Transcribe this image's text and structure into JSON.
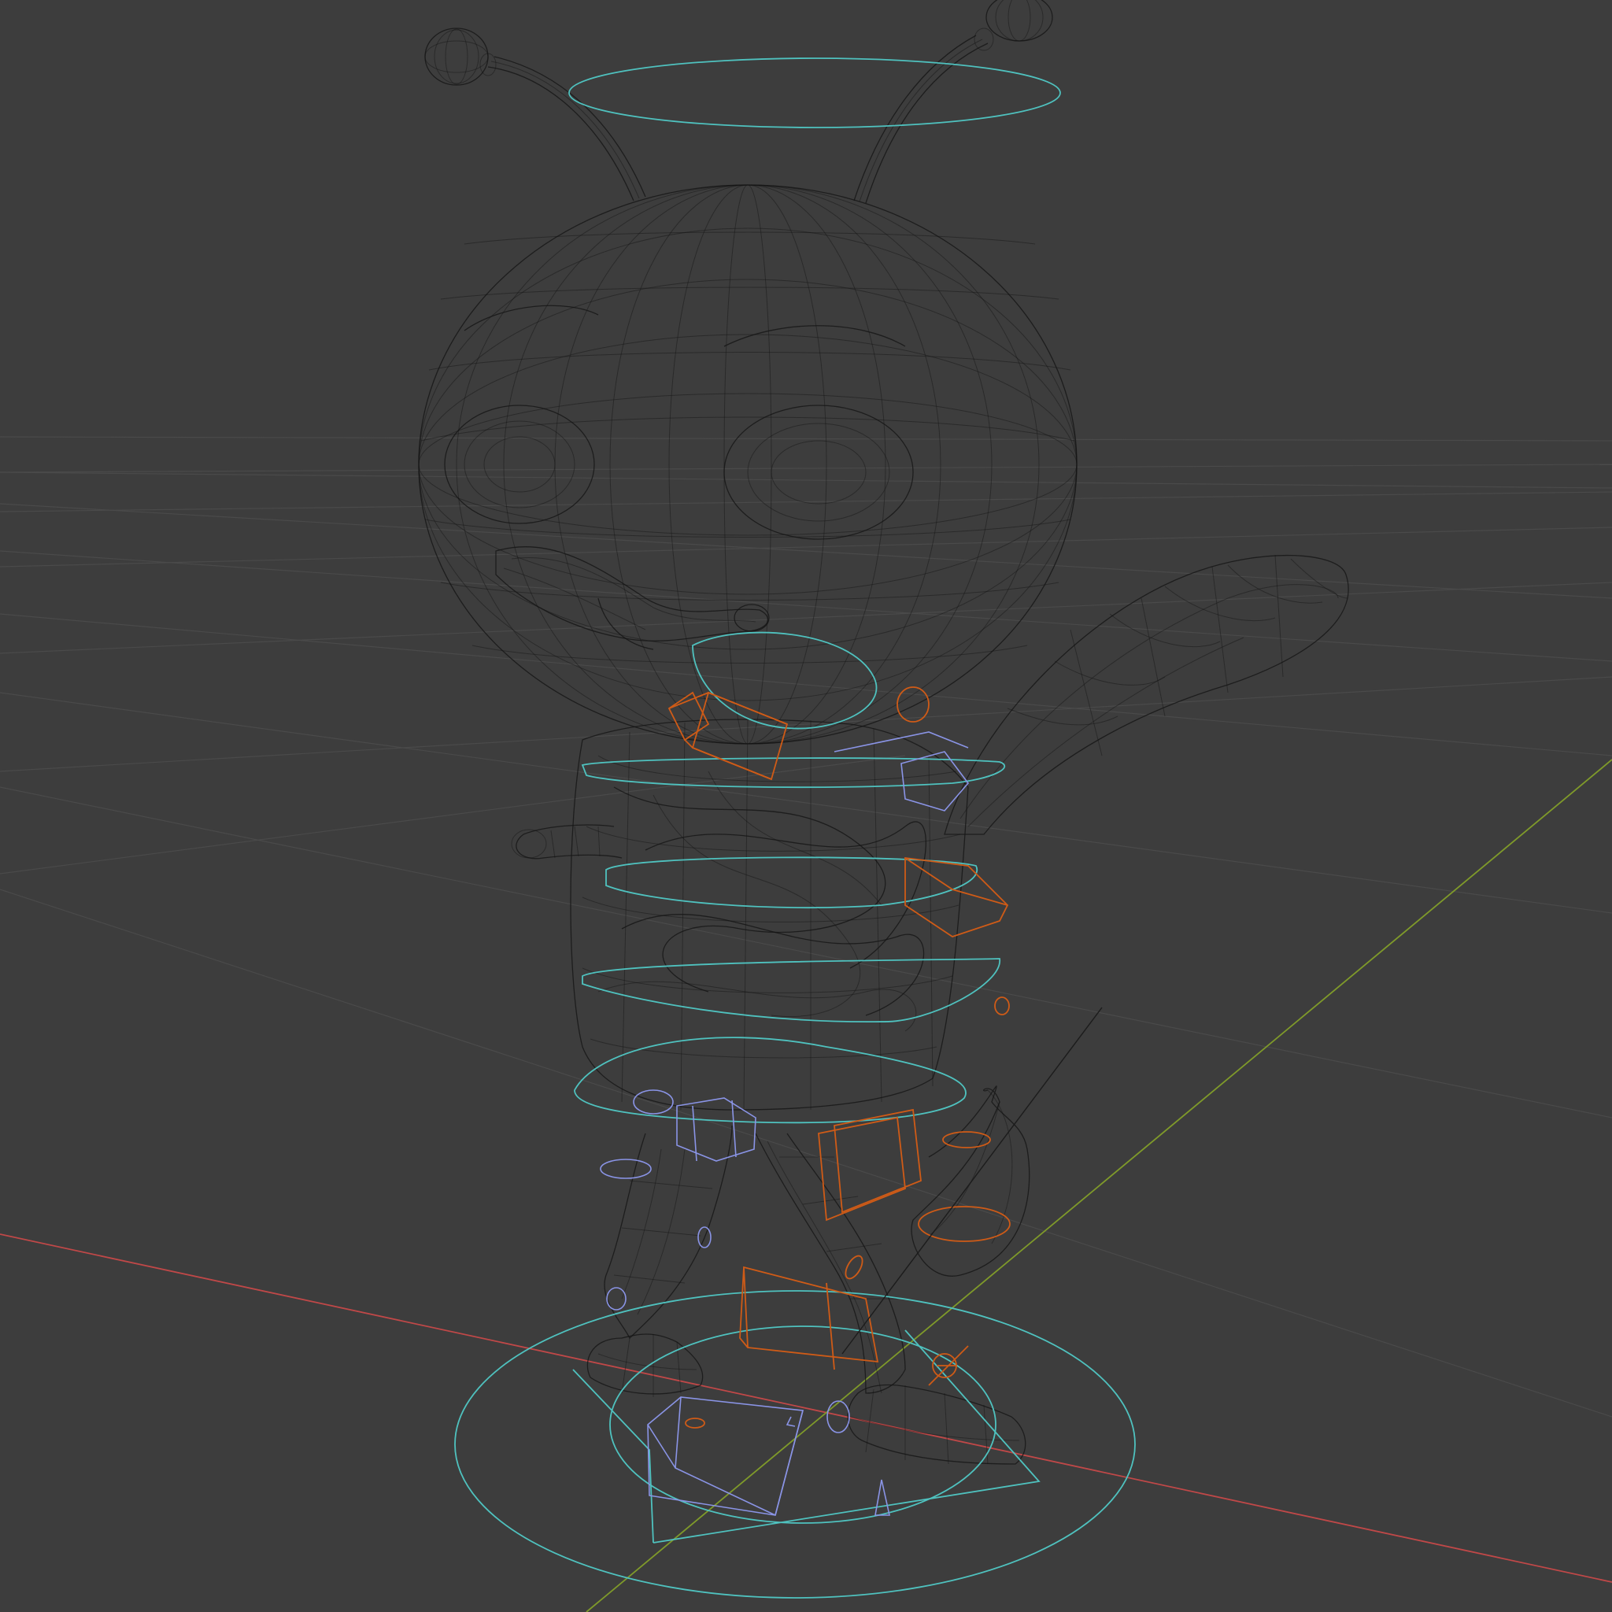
{
  "viewport": {
    "background": "#3d3d3d",
    "display_mode": "wireframe",
    "axes": {
      "x_axis_color": "#c04848",
      "y_axis_color": "#7f9a2a"
    },
    "object": {
      "type": "character mesh",
      "mesh_color": "#151515"
    },
    "rig_controls": {
      "ring_color": "#4fc2bf",
      "ik_box_color": "#cf5b17",
      "fk_box_color": "#8a94e6"
    }
  }
}
